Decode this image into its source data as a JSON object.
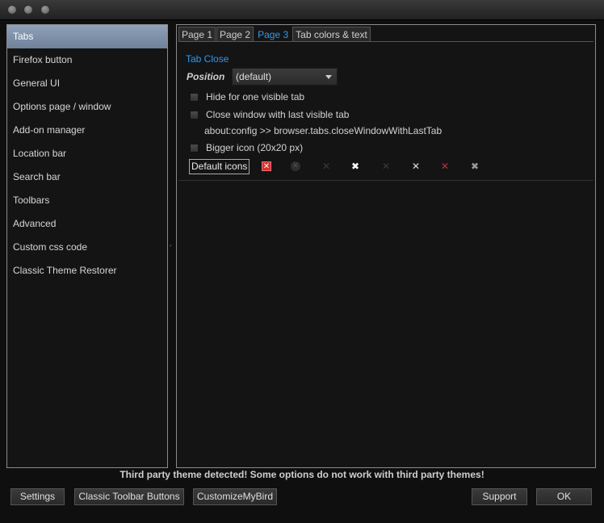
{
  "sidebar": {
    "items": [
      {
        "label": "Tabs",
        "selected": true
      },
      {
        "label": "Firefox button"
      },
      {
        "label": "General UI"
      },
      {
        "label": "Options page / window"
      },
      {
        "label": "Add-on manager"
      },
      {
        "label": "Location bar"
      },
      {
        "label": "Search bar"
      },
      {
        "label": "Toolbars"
      },
      {
        "label": "Advanced"
      },
      {
        "label": "Custom css code"
      },
      {
        "label": "Classic Theme Restorer"
      }
    ]
  },
  "tabs": [
    {
      "label": "Page 1"
    },
    {
      "label": "Page 2"
    },
    {
      "label": "Page 3",
      "active": true
    },
    {
      "label": "Tab colors & text"
    }
  ],
  "section": {
    "title": "Tab Close",
    "position_label": "Position",
    "position_value": "(default)",
    "hide_one_tab": "Hide for one visible tab",
    "close_window": "Close window with last visible tab",
    "about_config": "about:config >> browser.tabs.closeWindowWithLastTab",
    "bigger_icon": "Bigger icon (20x20 px)",
    "default_icons_label": "Default icons",
    "icons": [
      {
        "name": "close-red-box-icon",
        "color": "#d93030"
      },
      {
        "name": "close-dark-circle-icon",
        "color": "#555555"
      },
      {
        "name": "close-dark-faint-icon",
        "color": "#3a3a3a"
      },
      {
        "name": "close-white-bold-icon",
        "color": "#ffffff"
      },
      {
        "name": "close-dark-thin-icon",
        "color": "#3a3a3a"
      },
      {
        "name": "close-white-thin-icon",
        "color": "#e0e0e0"
      },
      {
        "name": "close-red-thin-icon",
        "color": "#c83232"
      },
      {
        "name": "close-gray-outline-icon",
        "color": "#9a9a9a"
      }
    ]
  },
  "warning": "Third party theme detected! Some options do not work with third party themes!",
  "buttons": {
    "settings": "Settings",
    "classic_toolbar": "Classic Toolbar Buttons",
    "customize_my_bird": "CustomizeMyBird",
    "support": "Support",
    "ok": "OK"
  },
  "colors": {
    "accent": "#2f9bf2",
    "selected_bg": "#7e91a8",
    "background": "#0f0f0f"
  }
}
